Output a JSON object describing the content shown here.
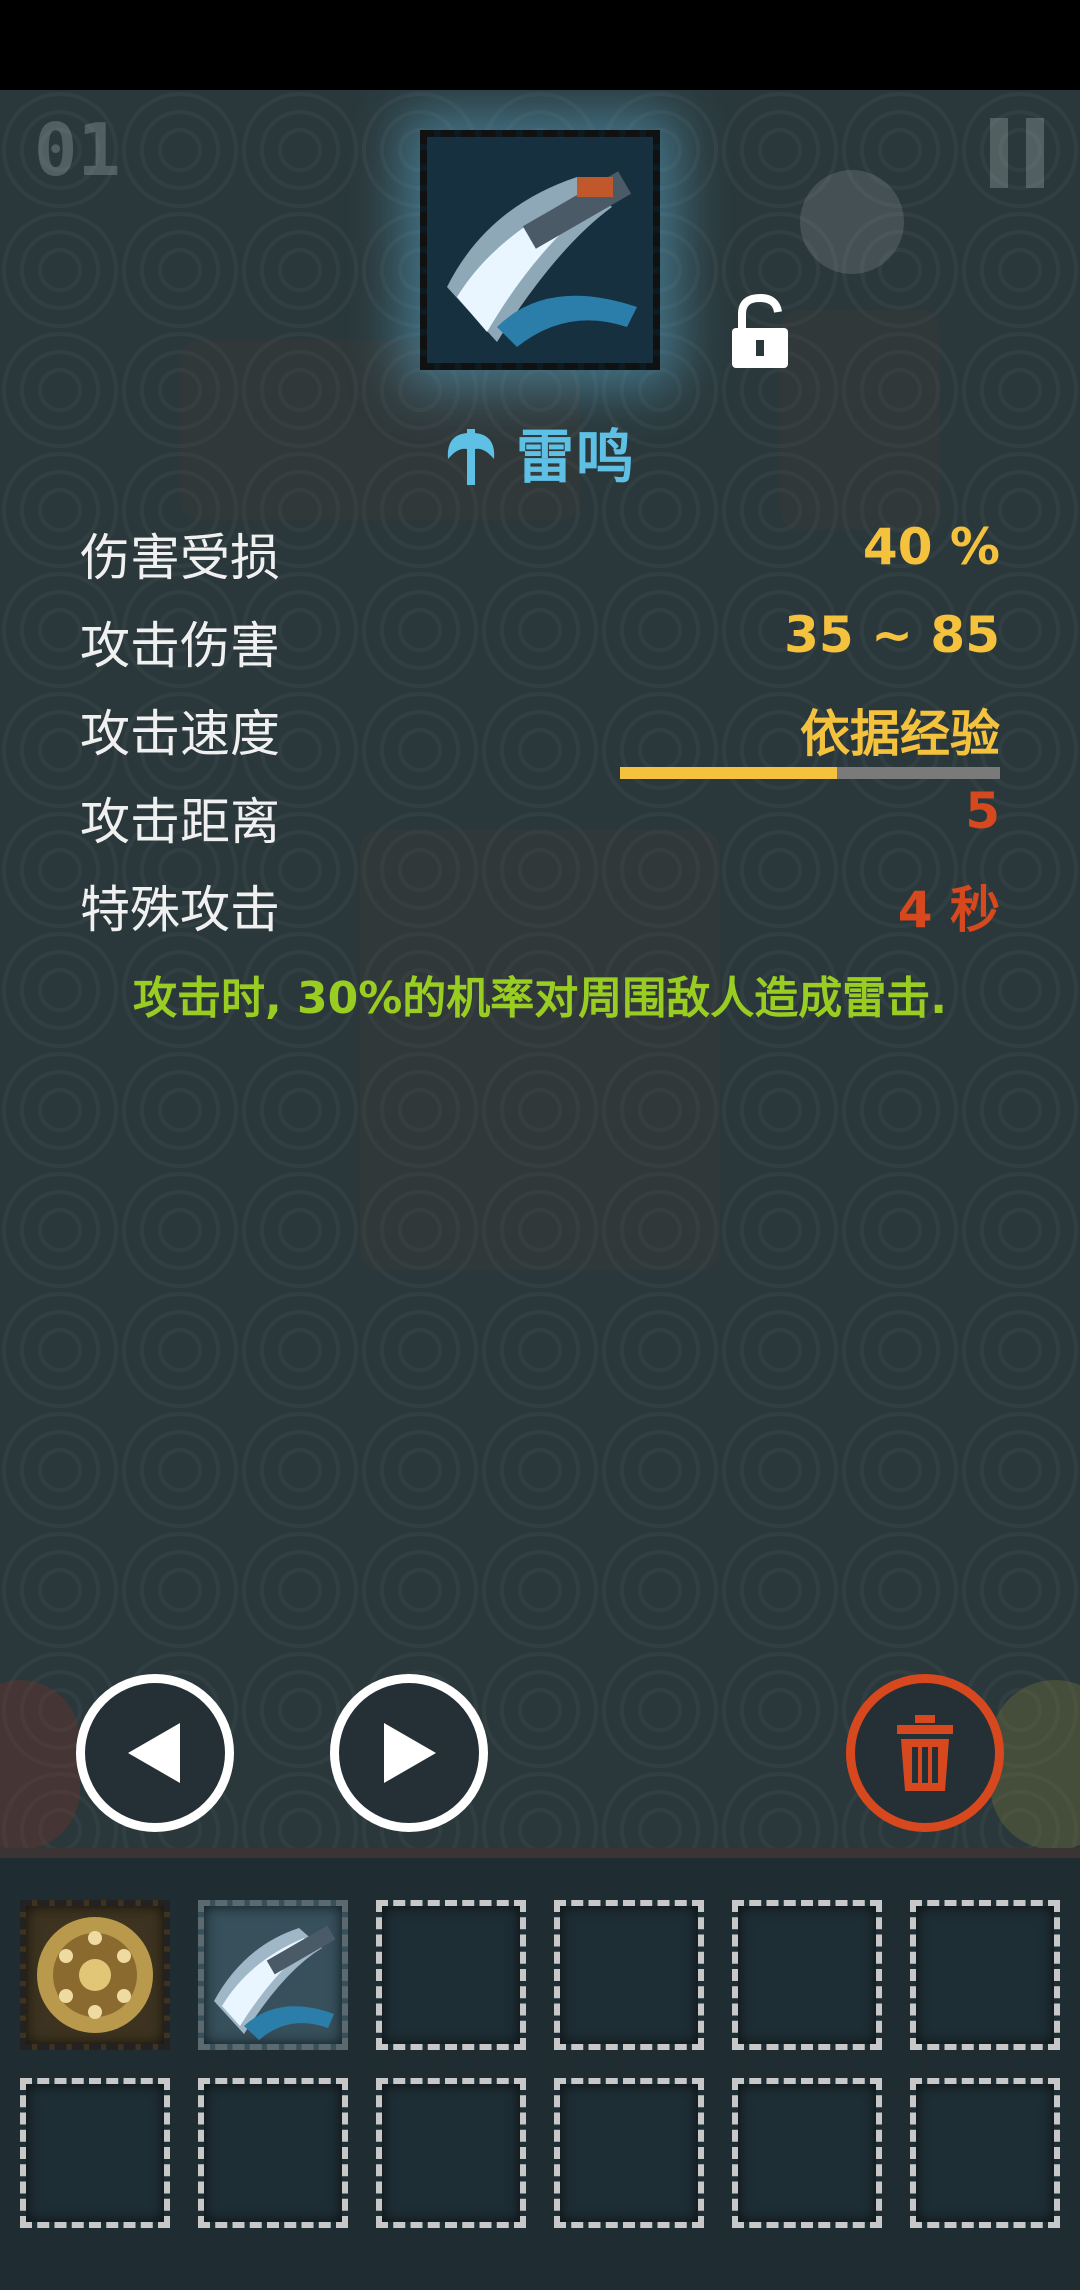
{
  "hud": {
    "counter": "01"
  },
  "item": {
    "name": "雷鸣",
    "type_icon": "axe-icon",
    "locked": false,
    "lock_icon": "unlock-icon"
  },
  "stats": [
    {
      "label": "伤害受损",
      "value": "40 %",
      "color": "#f5c23e"
    },
    {
      "label": "攻击伤害",
      "value": "35 ~ 85",
      "color": "#f5c23e"
    },
    {
      "label": "攻击速度",
      "value": "依据经验",
      "color": "#f5c23e"
    },
    {
      "label": "攻击距离",
      "value": "5",
      "color": "#d8481f"
    },
    {
      "label": "特殊攻击",
      "value": "4 秒",
      "color": "#d8481f"
    }
  ],
  "speed_progress": 0.57,
  "description": "攻击时, 30%的机率对周围敌人造成雷击.",
  "controls": {
    "prev_icon": "triangle-left-icon",
    "next_icon": "triangle-right-icon",
    "delete_icon": "trash-icon"
  },
  "inventory": {
    "slots": [
      {
        "item": "shield-item"
      },
      {
        "item": "axe-item"
      },
      {
        "item": ""
      },
      {
        "item": ""
      },
      {
        "item": ""
      },
      {
        "item": ""
      },
      {
        "item": ""
      },
      {
        "item": ""
      },
      {
        "item": ""
      },
      {
        "item": ""
      },
      {
        "item": ""
      },
      {
        "item": ""
      }
    ]
  },
  "colors": {
    "accent_blue": "#5fc0e5",
    "value_yellow": "#f5c23e",
    "value_red": "#d8481f",
    "desc_green": "#9acd22"
  }
}
